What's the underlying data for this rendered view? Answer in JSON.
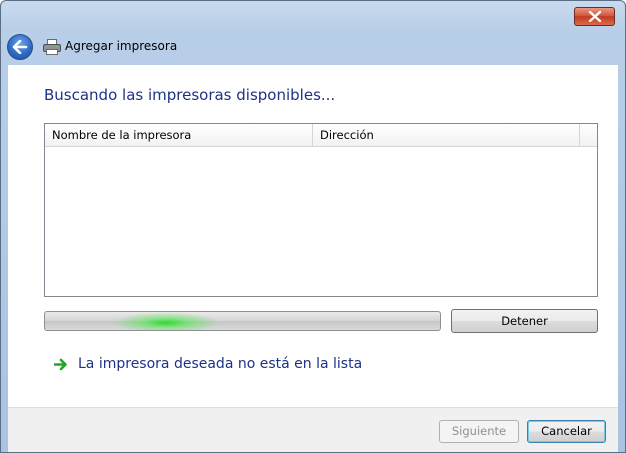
{
  "window": {
    "close_icon": "close-x-icon"
  },
  "nav": {
    "back_icon": "back-arrow-icon",
    "app_icon": "printer-icon",
    "title": "Agregar impresora"
  },
  "main": {
    "heading": "Buscando las impresoras disponibles...",
    "list": {
      "columns": [
        "Nombre de la impresora",
        "Dirección",
        ""
      ],
      "rows": []
    },
    "progress": {
      "state": "indeterminate",
      "color": "#2fd42f"
    },
    "stop_label": "Detener",
    "link_icon": "green-arrow-icon",
    "link_text": "La impresora deseada no está en la lista"
  },
  "footer": {
    "next_label": "Siguiente",
    "cancel_label": "Cancelar"
  },
  "colors": {
    "heading": "#1e3287",
    "link": "#1e3287",
    "close_button": "#c23b1f",
    "back_button": "#2f6cc6"
  }
}
